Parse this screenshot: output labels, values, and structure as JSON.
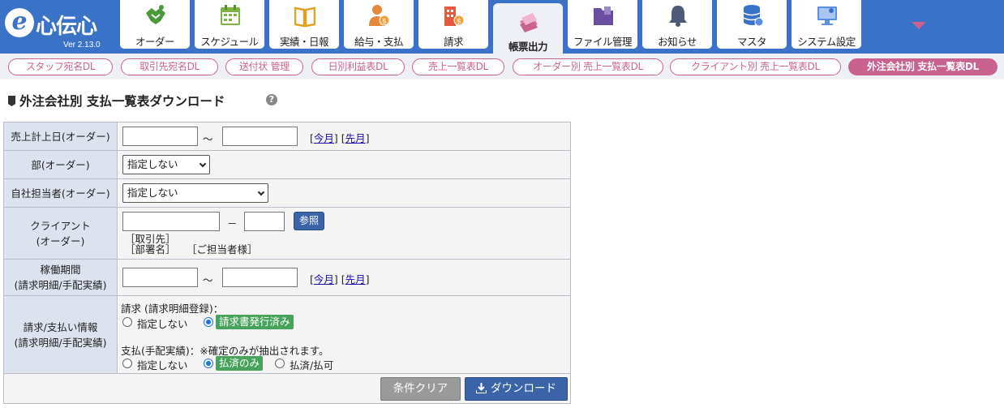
{
  "app": {
    "logo_text": "心伝心",
    "logo_mark": "e",
    "version": "Ver 2.13.0"
  },
  "tabs": [
    {
      "label": "オーダー",
      "icon": "handshake-icon"
    },
    {
      "label": "スケジュール",
      "icon": "calendar-icon"
    },
    {
      "label": "実績・日報",
      "icon": "book-icon"
    },
    {
      "label": "給与・支払",
      "icon": "person-money-icon"
    },
    {
      "label": "請求",
      "icon": "building-money-icon"
    },
    {
      "label": "帳票出力",
      "icon": "documents-icon",
      "active": true
    },
    {
      "label": "ファイル管理",
      "icon": "folder-icon"
    },
    {
      "label": "お知らせ",
      "icon": "bell-icon"
    },
    {
      "label": "マスタ",
      "icon": "database-icon"
    },
    {
      "label": "システム設定",
      "icon": "monitor-settings-icon"
    }
  ],
  "subnav": [
    {
      "label": "スタッフ宛名DL"
    },
    {
      "label": "取引先宛名DL"
    },
    {
      "label": "送付状 管理"
    },
    {
      "label": "日別利益表DL"
    },
    {
      "label": "売上一覧表DL"
    },
    {
      "label": "オーダー別 売上一覧表DL"
    },
    {
      "label": "クライアント別 売上一覧表DL"
    },
    {
      "label": "外注会社別 支払一覧表DL",
      "active": true
    }
  ],
  "page": {
    "title": "外注会社別 支払一覧表ダウンロード",
    "help": "?"
  },
  "form": {
    "sales_date": {
      "label": "売上計上日(オーダー)",
      "from_value": "",
      "to_value": "",
      "separator": "～",
      "this_month": "今月",
      "last_month": "先月"
    },
    "department": {
      "label": "部(オーダー)",
      "selected": "指定しない"
    },
    "staff": {
      "label": "自社担当者(オーダー)",
      "selected": "指定しない"
    },
    "client": {
      "label_line1": "クライアント",
      "label_line2": "(オーダー)",
      "code_value": "",
      "sub_value": "",
      "dash": "－",
      "ref_button": "参照",
      "info_client": "［取引先］",
      "info_dept": "［部署名］",
      "info_contact": "［ご担当者様］"
    },
    "work_period": {
      "label_line1": "稼働期間",
      "label_line2": "(請求明細/手配実績)",
      "from_value": "",
      "to_value": "",
      "separator": "～",
      "this_month": "今月",
      "last_month": "先月"
    },
    "billing": {
      "label_line1": "請求/支払い情報",
      "label_line2": "(請求明細/手配実績)",
      "invoice_heading": "請求 (請求明細登録)：",
      "invoice_opt_none": "指定しない",
      "invoice_opt_issued": "請求書発行済み",
      "payment_heading": "支払(手配実績)：※確定のみが抽出されます。",
      "payment_opt_none": "指定しない",
      "payment_opt_paid": "払済のみ",
      "payment_opt_paid_ok": "払済/払可"
    },
    "actions": {
      "clear": "条件クリア",
      "download": "ダウンロード"
    }
  },
  "colors": {
    "header_blue": "#3a72c8",
    "accent_pink": "#c9628f",
    "label_bg": "#dde3ee",
    "green_badge": "#47a35c",
    "button_blue": "#3b64a8"
  }
}
